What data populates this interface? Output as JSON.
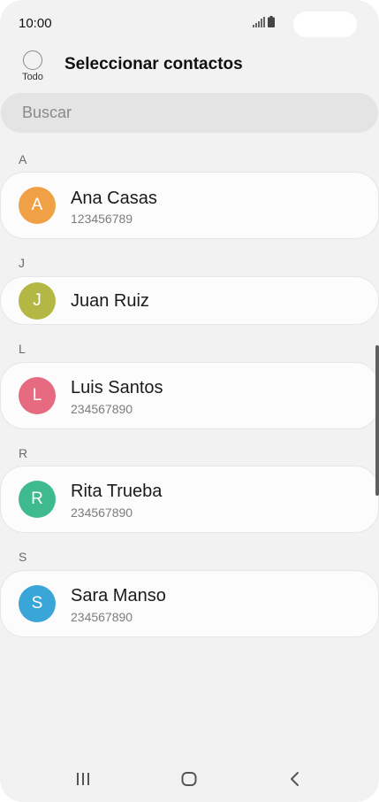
{
  "status_bar": {
    "time": "10:00"
  },
  "header": {
    "select_all_label": "Todo",
    "title": "Seleccionar contactos"
  },
  "search": {
    "placeholder": "Buscar",
    "value": ""
  },
  "sections": [
    {
      "letter": "A",
      "contacts": [
        {
          "initial": "A",
          "name": "Ana Casas",
          "phone": "123456789",
          "color": "#f0a145"
        }
      ]
    },
    {
      "letter": "J",
      "contacts": [
        {
          "initial": "J",
          "name": "Juan Ruiz",
          "phone": "",
          "color": "#b3b844"
        }
      ]
    },
    {
      "letter": "L",
      "contacts": [
        {
          "initial": "L",
          "name": "Luis Santos",
          "phone": "234567890",
          "color": "#e66a80"
        }
      ]
    },
    {
      "letter": "R",
      "contacts": [
        {
          "initial": "R",
          "name": "Rita Trueba",
          "phone": "234567890",
          "color": "#3fba8e"
        }
      ]
    },
    {
      "letter": "S",
      "contacts": [
        {
          "initial": "S",
          "name": "Sara Manso",
          "phone": "234567890",
          "color": "#3aa6d8"
        }
      ]
    }
  ],
  "nav_bar": {
    "buttons": [
      "recent-apps-icon",
      "home-icon",
      "back-icon"
    ]
  }
}
